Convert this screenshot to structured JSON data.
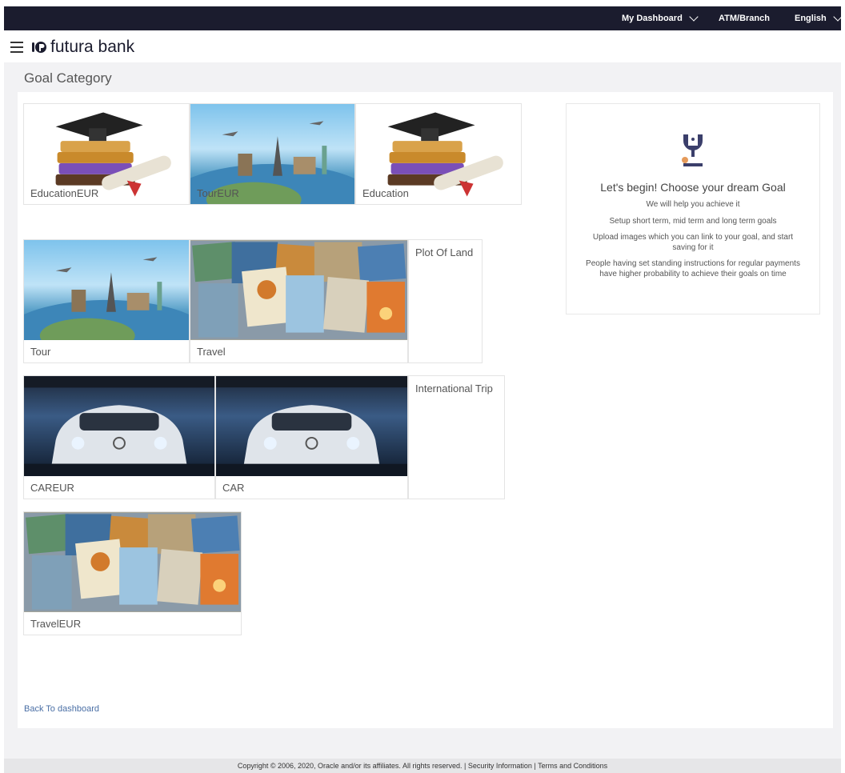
{
  "topbar": {
    "dashboard_label": "My Dashboard",
    "atm_label": "ATM/Branch",
    "language_label": "English"
  },
  "header": {
    "brand": "futura bank"
  },
  "page": {
    "title": "Goal Category"
  },
  "tiles": [
    {
      "label": "EducationEUR",
      "image": "education-illustration"
    },
    {
      "label": "TourEUR",
      "image": "tour-illustration"
    },
    {
      "label": "Education",
      "image": "education-illustration"
    },
    {
      "label": "Tour",
      "image": "tour-illustration"
    },
    {
      "label": "Travel",
      "image": "travel-collage"
    },
    {
      "label": "Plot Of Land",
      "image": ""
    },
    {
      "label": "CAREUR",
      "image": "car-photo"
    },
    {
      "label": "CAR",
      "image": "car-photo"
    },
    {
      "label": "International Trip",
      "image": ""
    },
    {
      "label": "TravelEUR",
      "image": "travel-collage"
    }
  ],
  "info": {
    "icon": "trophy-icon",
    "heading": "Let's begin! Choose your dream Goal",
    "lines": [
      "We will help you achieve it",
      "Setup short term, mid term and long term goals",
      "Upload images which you can link to your goal, and start saving for it",
      "People having set standing instructions for regular payments have higher probability to achieve their goals on time"
    ]
  },
  "back_link": "Back To dashboard",
  "footer": {
    "copyright": "Copyright © 2006, 2020, Oracle and/or its affiliates. All rights reserved.",
    "security": "Security Information",
    "terms": "Terms and Conditions"
  },
  "colors": {
    "topbar": "#1b1c2e",
    "link": "#4a6fa5"
  }
}
